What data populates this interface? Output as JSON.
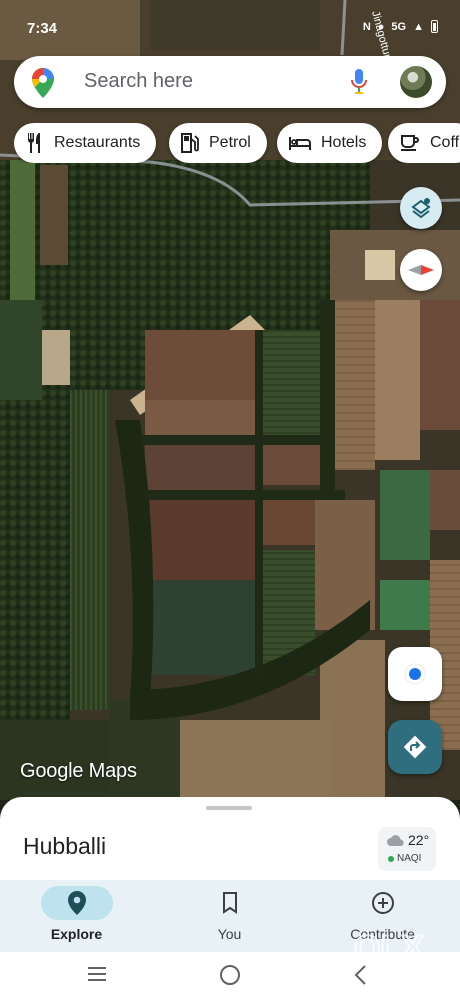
{
  "status_bar": {
    "time": "7:34",
    "network": "5G"
  },
  "search": {
    "placeholder": "Search here"
  },
  "chips": [
    {
      "label": "Restaurants",
      "icon": "restaurant-icon"
    },
    {
      "label": "Petrol",
      "icon": "gas-station-icon"
    },
    {
      "label": "Hotels",
      "icon": "hotel-icon"
    },
    {
      "label": "Coff",
      "icon": "coffee-icon"
    }
  ],
  "map": {
    "road_label": "Jinagottur Rd",
    "attribution": "Google Maps",
    "view": "satellite"
  },
  "sheet": {
    "place": "Hubballi",
    "weather": {
      "temperature": "22°",
      "air_quality": "NAQI"
    }
  },
  "nav": {
    "items": [
      {
        "label": "Explore",
        "icon": "explore-pin-icon",
        "active": true
      },
      {
        "label": "You",
        "icon": "bookmark-icon",
        "active": false
      },
      {
        "label": "Contribute",
        "icon": "add-circle-icon",
        "active": false
      }
    ]
  },
  "colors": {
    "accent": "#1a73e8",
    "directions": "#2e6e7e",
    "nav_background": "#e8f1f5",
    "nav_active_pill": "#bfe3ee"
  },
  "watermark": "OLX"
}
